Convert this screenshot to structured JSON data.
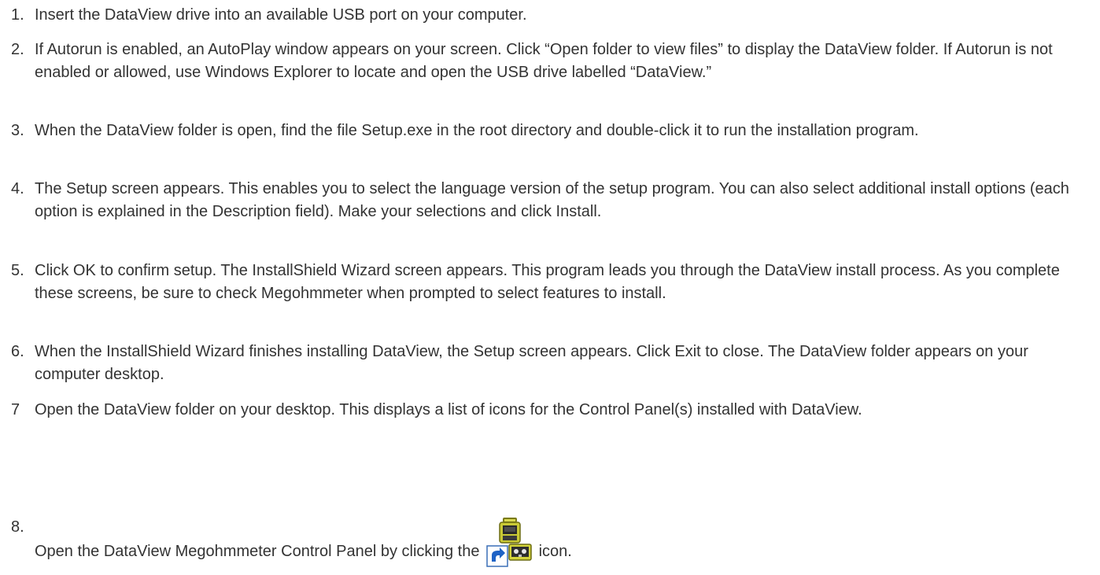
{
  "steps": [
    {
      "num": "1.",
      "text": "Insert the DataView drive into an available USB port on your computer."
    },
    {
      "num": "2.",
      "text": "If Autorun is enabled, an AutoPlay window appears on your screen. Click “Open folder to view files” to display the DataView folder. If Autorun is not enabled or allowed, use Windows Explorer to locate and open the USB drive labelled “DataView.”"
    },
    {
      "num": "3.",
      "text": "When the DataView folder is open, find the file Setup.exe in the root directory and double-click it to run the installation program."
    },
    {
      "num": "4.",
      "text": "The Setup screen appears. This enables you to select the language version of the setup program. You can also select additional install options (each option is explained in the Description field). Make your selections and click Install."
    },
    {
      "num": "5.",
      "text": "Click OK to confirm setup. The InstallShield Wizard screen appears. This program leads you through the DataView install process. As you complete these screens, be sure to check Megohmmeter when prompted to select features to install."
    },
    {
      "num": "6.",
      "text": "When the InstallShield Wizard finishes installing DataView, the Setup screen appears. Click Exit to close. The DataView folder appears on your computer desktop."
    },
    {
      "num": "7",
      "text": "Open the DataView folder on your desktop. This displays a list of icons for the Control Panel(s) installed with DataView."
    },
    {
      "num": "8.",
      "text_before": "Open the DataView Megohmmeter Control Panel by clicking the",
      "icon": "megohmmeter-control-panel-shortcut-icon",
      "text_after": "icon."
    }
  ]
}
